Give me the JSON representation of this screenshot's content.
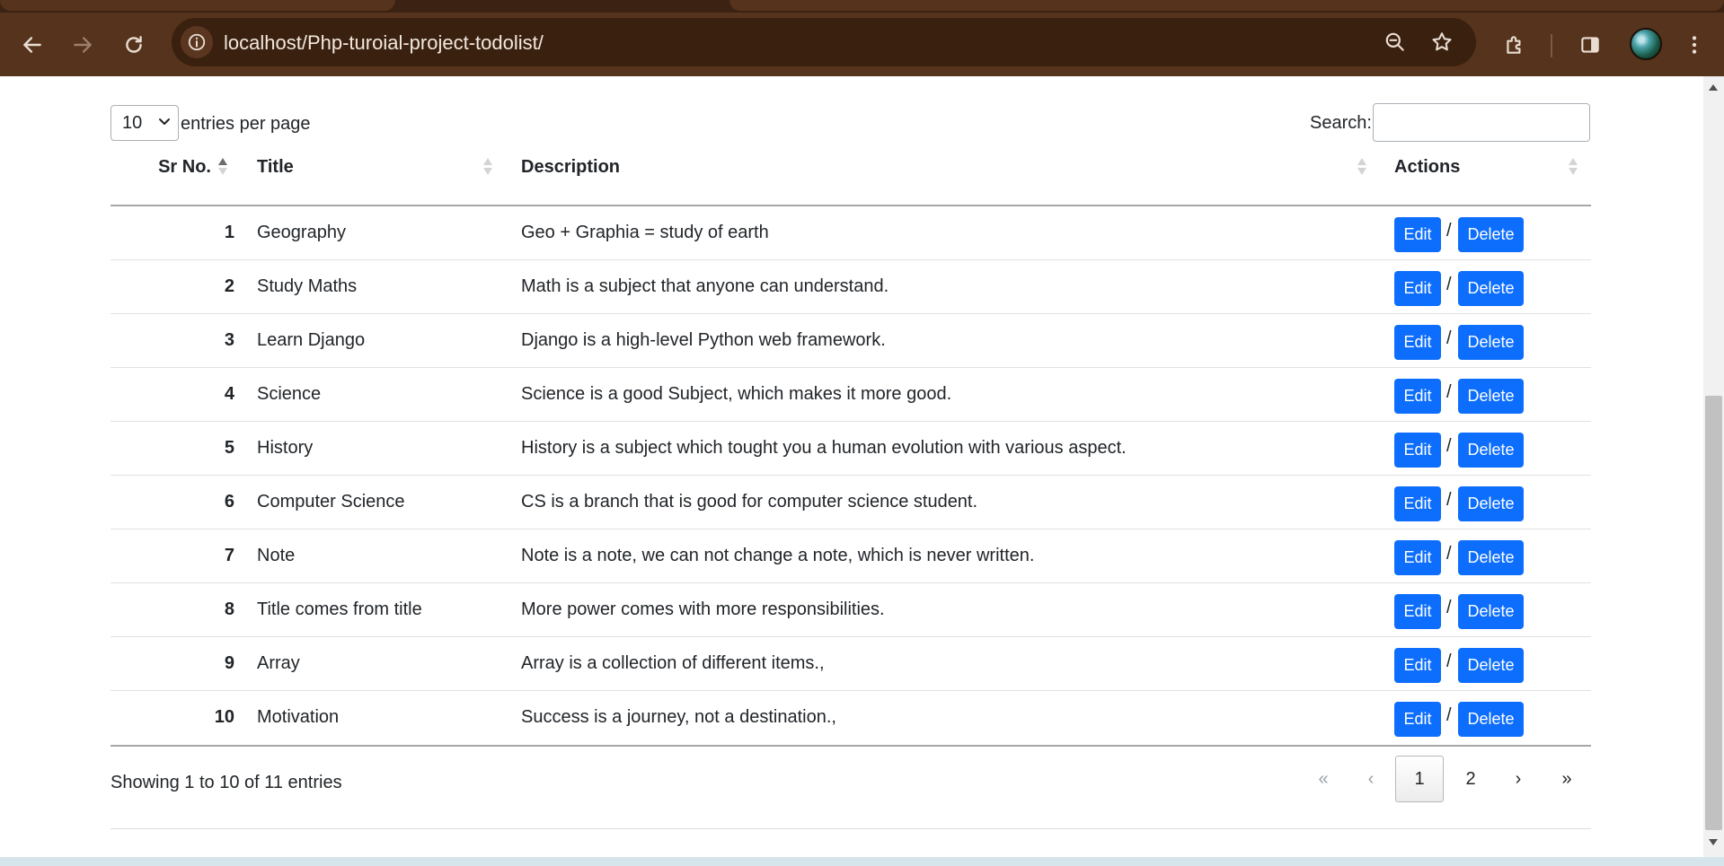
{
  "browser": {
    "url": "localhost/Php-turoial-project-todolist/",
    "icons": {
      "back": "arrow-left-icon",
      "forward": "arrow-right-icon",
      "reload": "reload-icon",
      "site_info": "info-icon",
      "zoom": "zoom-out-icon",
      "bookmark": "star-icon",
      "extensions": "puzzle-icon",
      "side_panel": "side-panel-icon",
      "profile": "avatar",
      "menu": "kebab-menu-icon"
    }
  },
  "table_controls": {
    "page_length_value": "10",
    "page_length_label": "entries per page",
    "search_label": "Search:",
    "search_value": ""
  },
  "columns": [
    "Sr No.",
    "Title",
    "Description",
    "Actions"
  ],
  "rows": [
    {
      "sr": "1",
      "title": "Geography",
      "description": "Geo + Graphia = study of earth"
    },
    {
      "sr": "2",
      "title": "Study Maths",
      "description": "Math is a subject that anyone can understand."
    },
    {
      "sr": "3",
      "title": "Learn Django",
      "description": "Django is a high-level Python web framework."
    },
    {
      "sr": "4",
      "title": "Science",
      "description": "Science is a good Subject, which makes it more good."
    },
    {
      "sr": "5",
      "title": "History",
      "description": "History is a subject which tought you a human evolution with various aspect."
    },
    {
      "sr": "6",
      "title": "Computer Science",
      "description": "CS is a branch that is good for computer science student."
    },
    {
      "sr": "7",
      "title": "Note",
      "description": "Note is a note, we can not change a note, which is never written."
    },
    {
      "sr": "8",
      "title": "Title comes from title",
      "description": "More power comes with more responsibilities."
    },
    {
      "sr": "9",
      "title": "Array",
      "description": "Array is a collection of different items.,"
    },
    {
      "sr": "10",
      "title": "Motivation",
      "description": "Success is a journey, not a destination.,"
    }
  ],
  "actions": {
    "edit_label": "Edit",
    "separator": "/",
    "delete_label": "Delete"
  },
  "footer": {
    "info": "Showing 1 to 10 of 11 entries",
    "pagination": {
      "first": "«",
      "prev": "‹",
      "pages": [
        "1",
        "2"
      ],
      "current": "1",
      "next": "›",
      "last": "»"
    }
  },
  "colors": {
    "chrome_bg": "#55331c",
    "omnibox_bg": "#3a200f",
    "primary_button": "#0d6efd"
  }
}
